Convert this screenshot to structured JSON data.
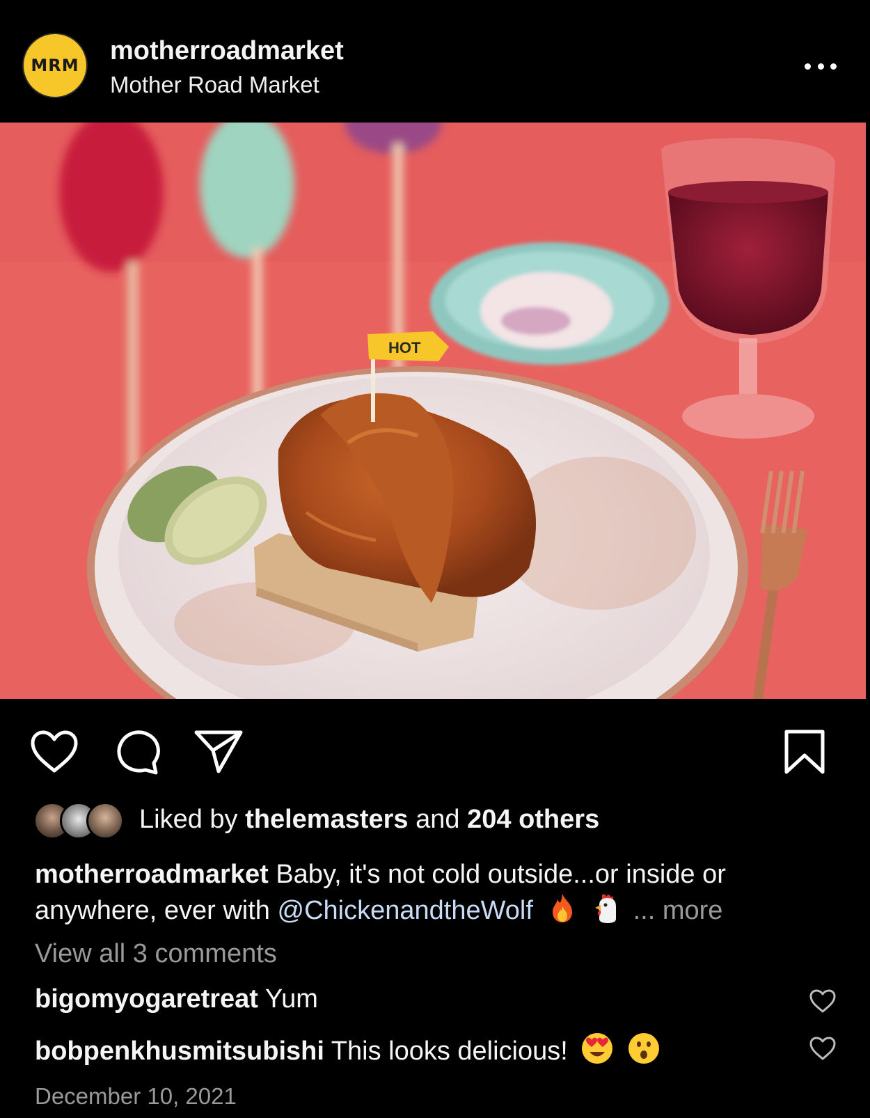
{
  "post": {
    "avatar_text": "MRM",
    "username": "motherroadmarket",
    "full_name": "Mother Road Market",
    "photo_flag_text": "HOT",
    "likes": {
      "prefix": "Liked by",
      "liker": "thelemasters",
      "and": "and",
      "others": "204 others"
    },
    "caption": {
      "username": "motherroadmarket",
      "text": "Baby, it's not cold outside...or inside or anywhere, ever with",
      "mention": "@ChickenandtheWolf",
      "emojis": [
        "fire-emoji",
        "chicken-emoji"
      ],
      "more": "... more"
    },
    "view_all_comments": "View all 3 comments",
    "comments": [
      {
        "username": "bigomyogaretreat",
        "text": "Yum"
      },
      {
        "username": "bobpenkhusmitsubishi",
        "text": "This looks delicious!",
        "emojis": [
          "heart-eyes-emoji",
          "surprised-emoji"
        ]
      }
    ],
    "date": "December 10, 2021"
  },
  "colors": {
    "background": "#000000",
    "avatar_yellow": "#f7c628",
    "mention_blue": "#c9dcf5",
    "muted_gray": "#9a9a9a"
  }
}
